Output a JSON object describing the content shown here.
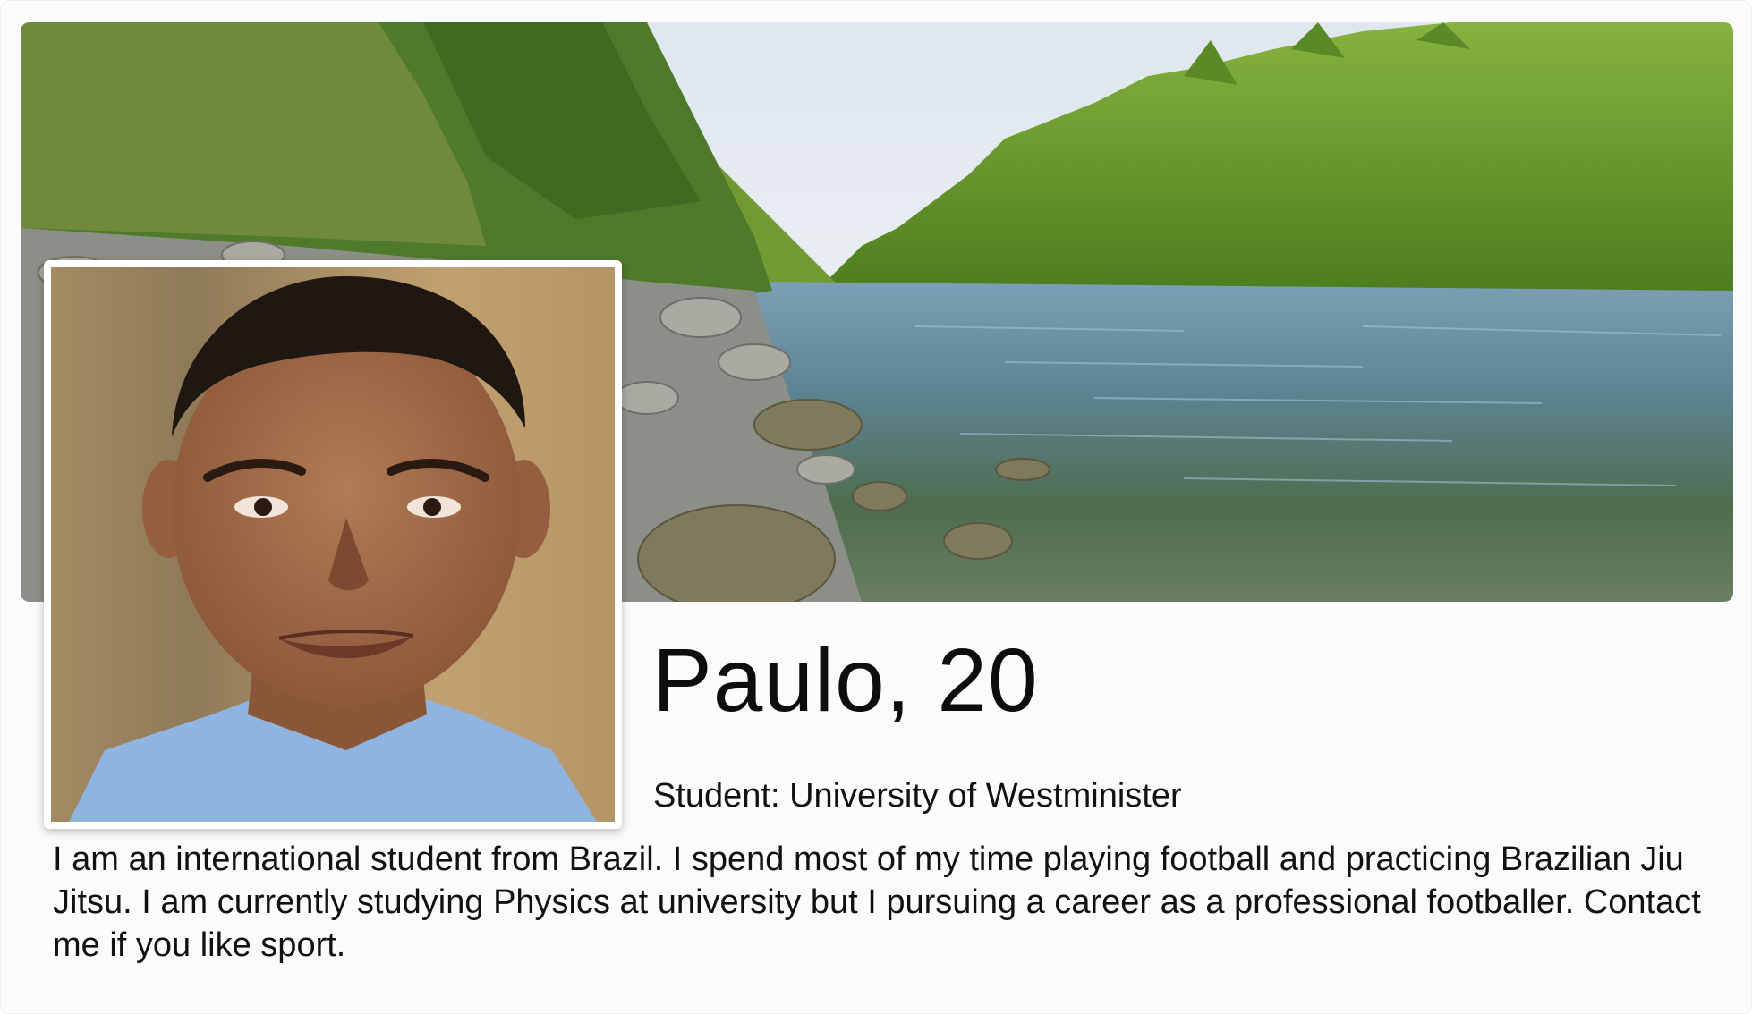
{
  "profile": {
    "name_age": "Paulo, 20",
    "occupation": "Student: University of Westminister",
    "bio": "I am an international student from Brazil. I spend most of my time playing football and practicing Brazilian Jiu Jitsu. I am currently studying Physics at university but I pursuing a career as a professional footballer. Contact me if you like sport."
  },
  "images": {
    "cover": "river-forest-landscape",
    "avatar": "profile-portrait"
  },
  "colors": {
    "background": "#fbfbfb",
    "text": "#111111",
    "frame": "#ffffff"
  }
}
